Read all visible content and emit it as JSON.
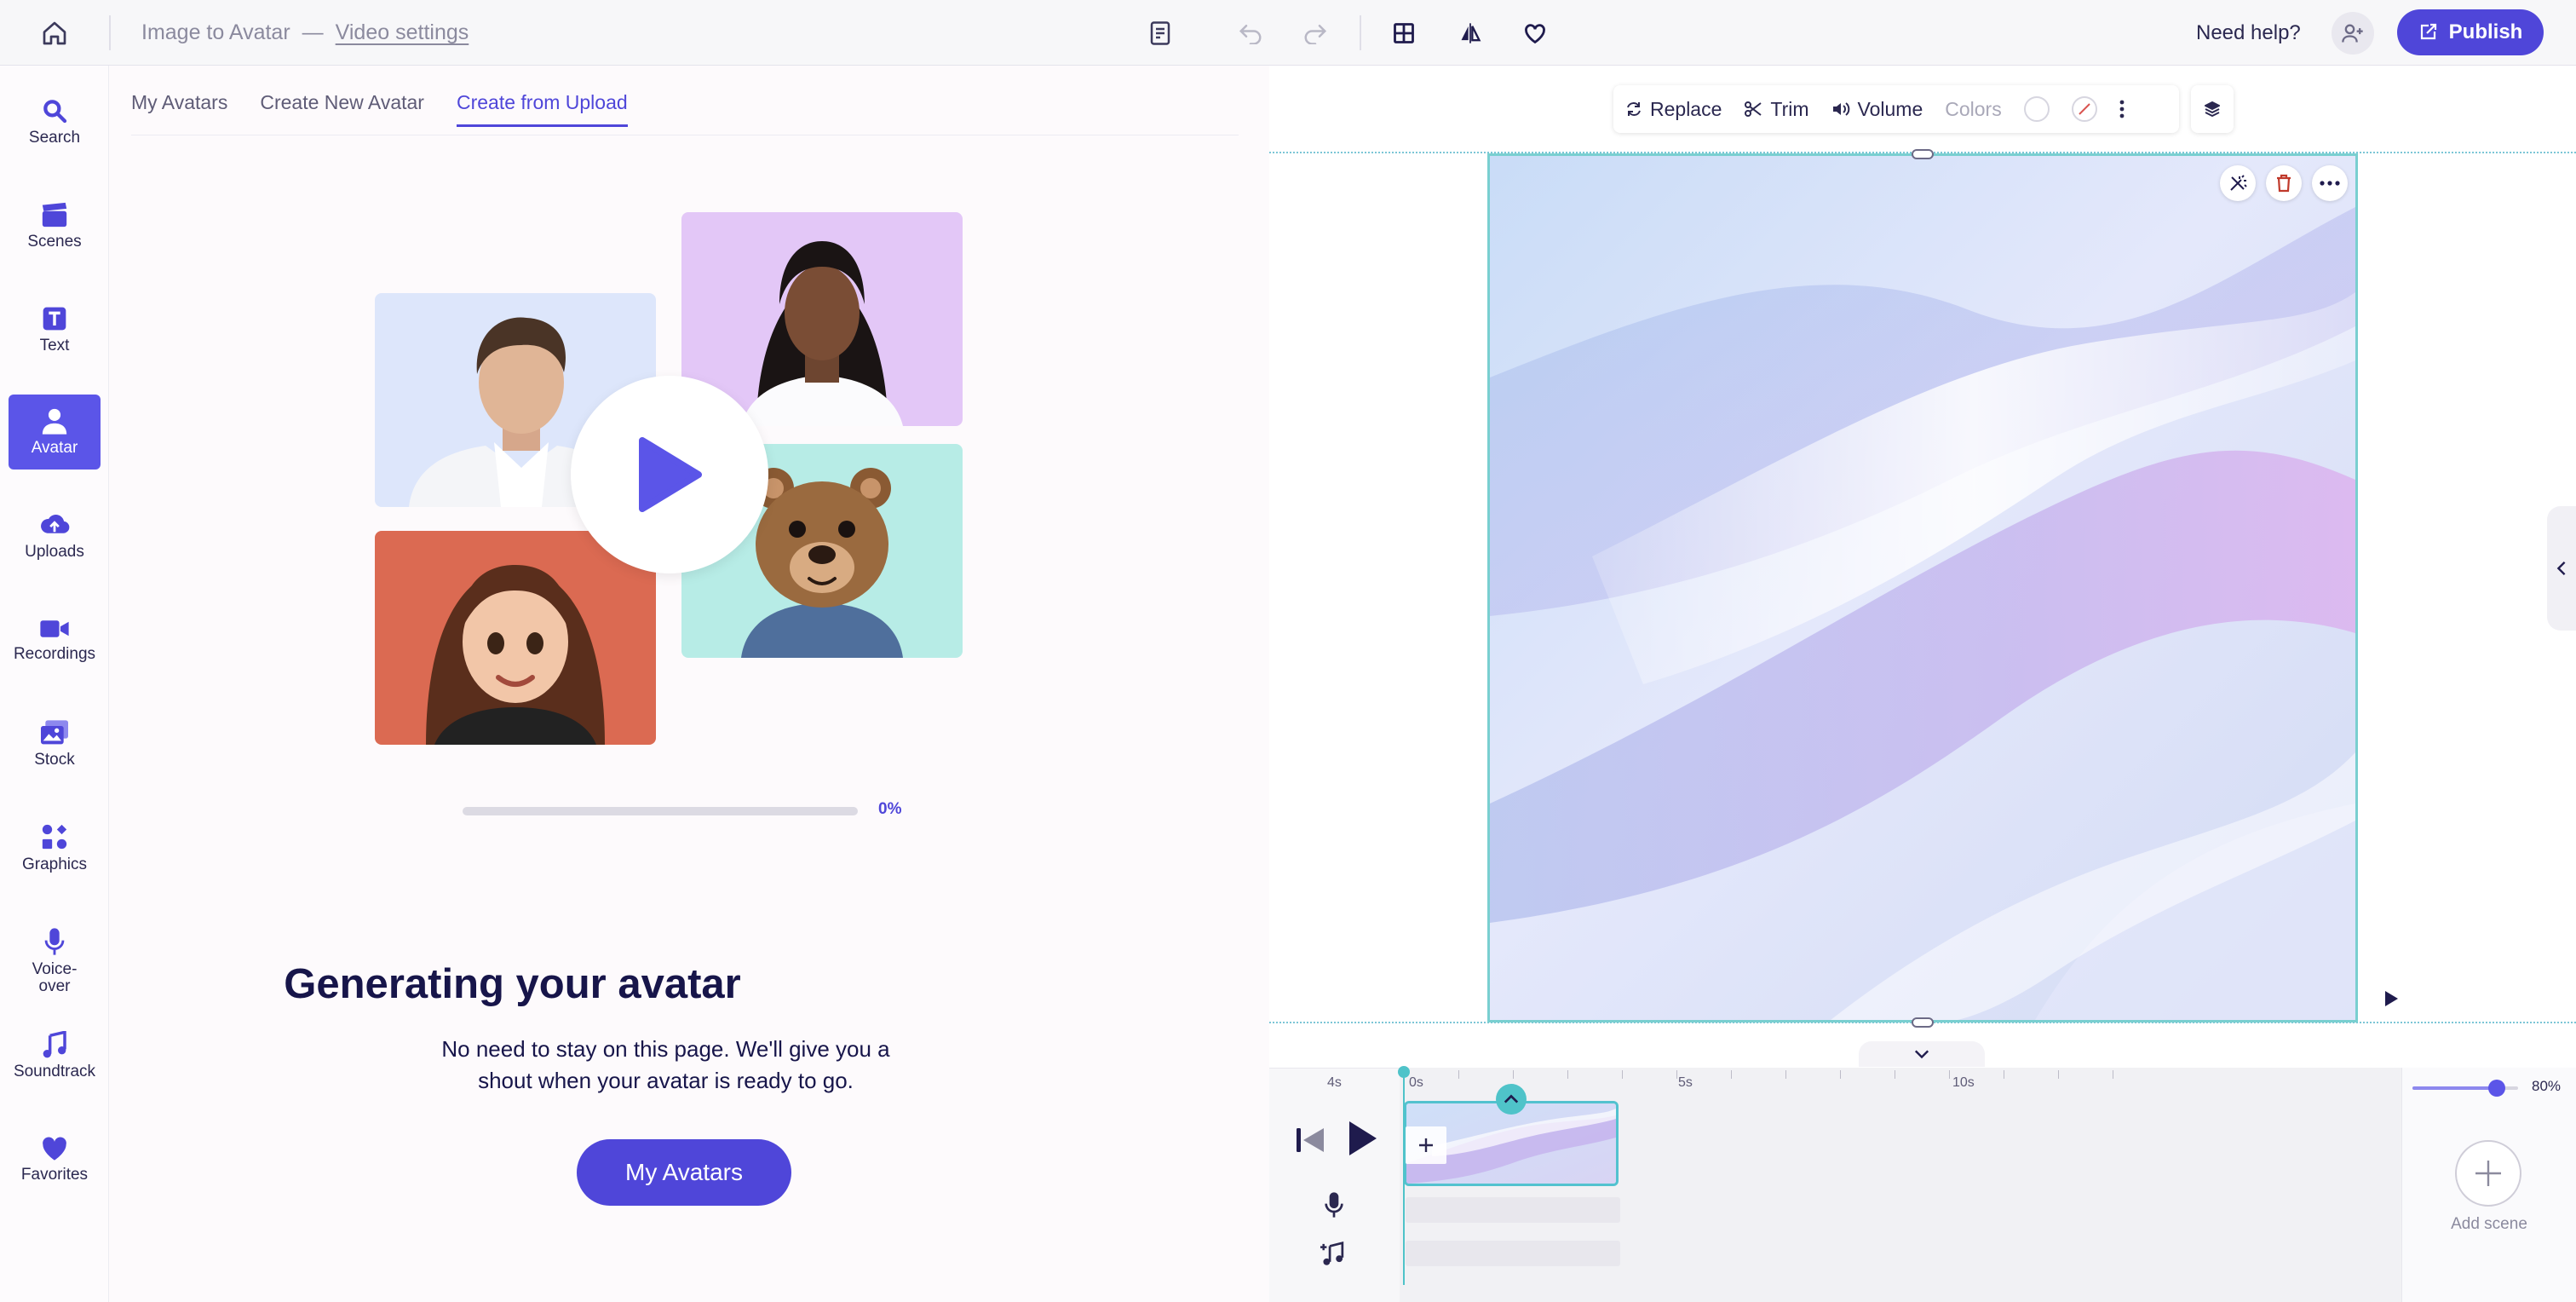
{
  "header": {
    "project_name": "Image to Avatar",
    "separator": "—",
    "video_settings_link": "Video settings",
    "need_help": "Need help?",
    "publish_label": "Publish"
  },
  "sidebar": {
    "items": [
      {
        "label": "Search",
        "icon": "search-icon"
      },
      {
        "label": "Scenes",
        "icon": "clapperboard-icon"
      },
      {
        "label": "Text",
        "icon": "text-icon"
      },
      {
        "label": "Avatar",
        "icon": "person-icon",
        "active": true
      },
      {
        "label": "Uploads",
        "icon": "cloud-upload-icon"
      },
      {
        "label": "Recordings",
        "icon": "video-camera-icon"
      },
      {
        "label": "Stock",
        "icon": "image-stack-icon"
      },
      {
        "label": "Graphics",
        "icon": "shapes-icon"
      },
      {
        "label": "Voice-\nover",
        "icon": "microphone-icon"
      },
      {
        "label": "Soundtrack",
        "icon": "music-note-icon"
      },
      {
        "label": "Favorites",
        "icon": "heart-icon"
      }
    ]
  },
  "panel": {
    "tabs": [
      {
        "label": "My Avatars"
      },
      {
        "label": "Create New Avatar"
      },
      {
        "label": "Create from Upload",
        "active": true
      }
    ],
    "progress_label": "0%",
    "progress_value": 0,
    "title": "Generating your avatar",
    "description": "No need to stay on this page. We'll give you a shout when your avatar is ready to go.",
    "button_label": "My Avatars"
  },
  "canvas_toolbar": {
    "replace": "Replace",
    "trim": "Trim",
    "volume": "Volume",
    "colors": "Colors"
  },
  "timeline": {
    "ticks": [
      "4s",
      "0s",
      "5s",
      "10s"
    ],
    "zoom": "80%",
    "zoom_value": 0.8,
    "add_scene": "Add scene"
  },
  "colors": {
    "accent": "#4f46d9",
    "selection": "#79cfd0"
  }
}
